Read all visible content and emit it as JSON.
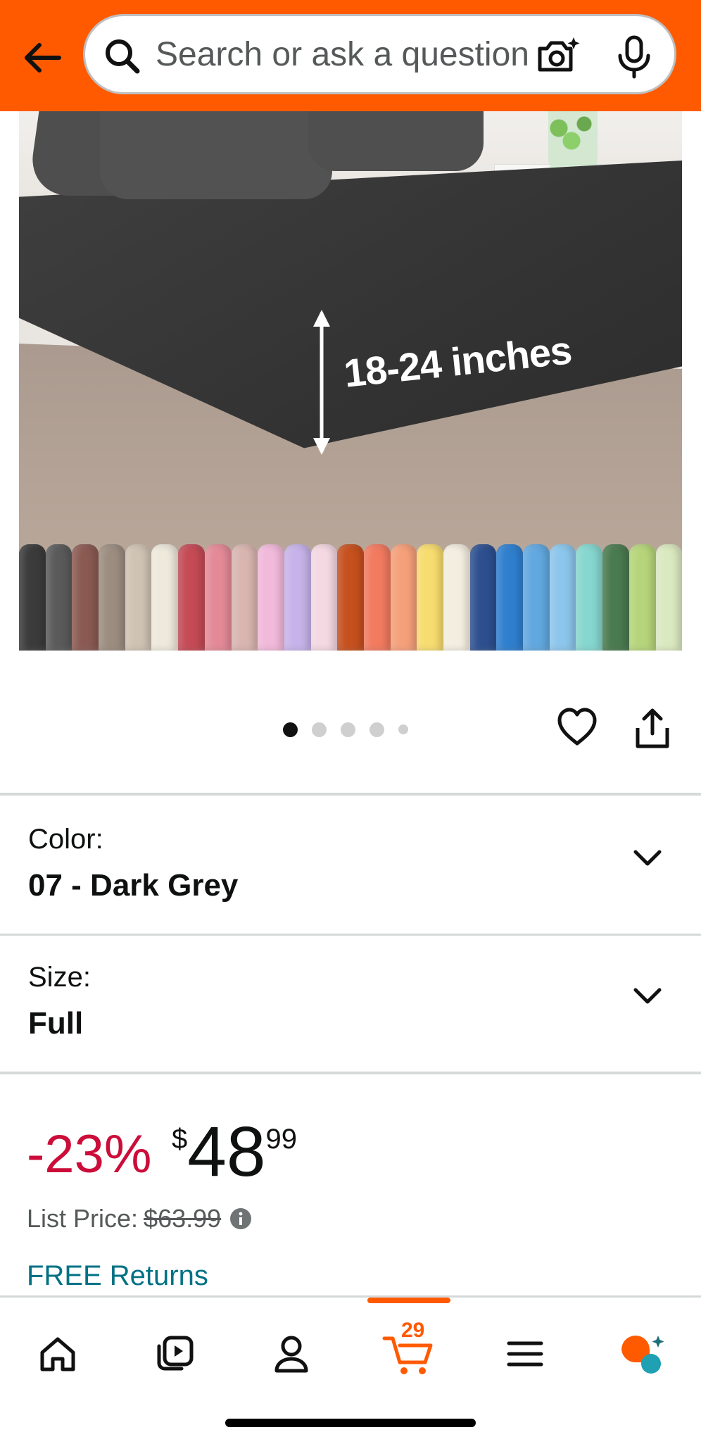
{
  "search": {
    "placeholder": "Search or ask a question"
  },
  "product_image": {
    "dimension_label": "18-24 inches",
    "swatch_colors": [
      "#3b3b3b",
      "#5a5a5a",
      "#8a5a52",
      "#9c8d80",
      "#cfc3b3",
      "#efe9dc",
      "#c44a55",
      "#e48a97",
      "#d9b5b0",
      "#f1b9da",
      "#c7b3ea",
      "#f4d8e2",
      "#c6501e",
      "#f27a5f",
      "#f5a07a",
      "#f7dc6f",
      "#f3eee0",
      "#2d4f8f",
      "#2f7fcf",
      "#62a8e0",
      "#8cc6ec",
      "#86d7cf",
      "#4a7a4f",
      "#b6d57a",
      "#dbe9c0"
    ]
  },
  "gallery": {
    "total_images": 5,
    "current_image": 1
  },
  "variations": [
    {
      "label": "Color:",
      "value": "07 - Dark Grey"
    },
    {
      "label": "Size:",
      "value": "Full"
    }
  ],
  "price": {
    "discount": "-23%",
    "currency": "$",
    "whole": "48",
    "fraction": "99",
    "list_label": "List Price:",
    "list_value": "$63.99"
  },
  "returns": "FREE Returns",
  "nav": {
    "items": [
      "home-icon",
      "video-library-icon",
      "account-icon",
      "cart-icon",
      "menu-icon",
      "rufus-assistant-icon"
    ],
    "cart_count": "29"
  },
  "colors": {
    "brand_orange": "#ff5a00",
    "discount_red": "#cc0c39",
    "link_teal": "#007185"
  }
}
